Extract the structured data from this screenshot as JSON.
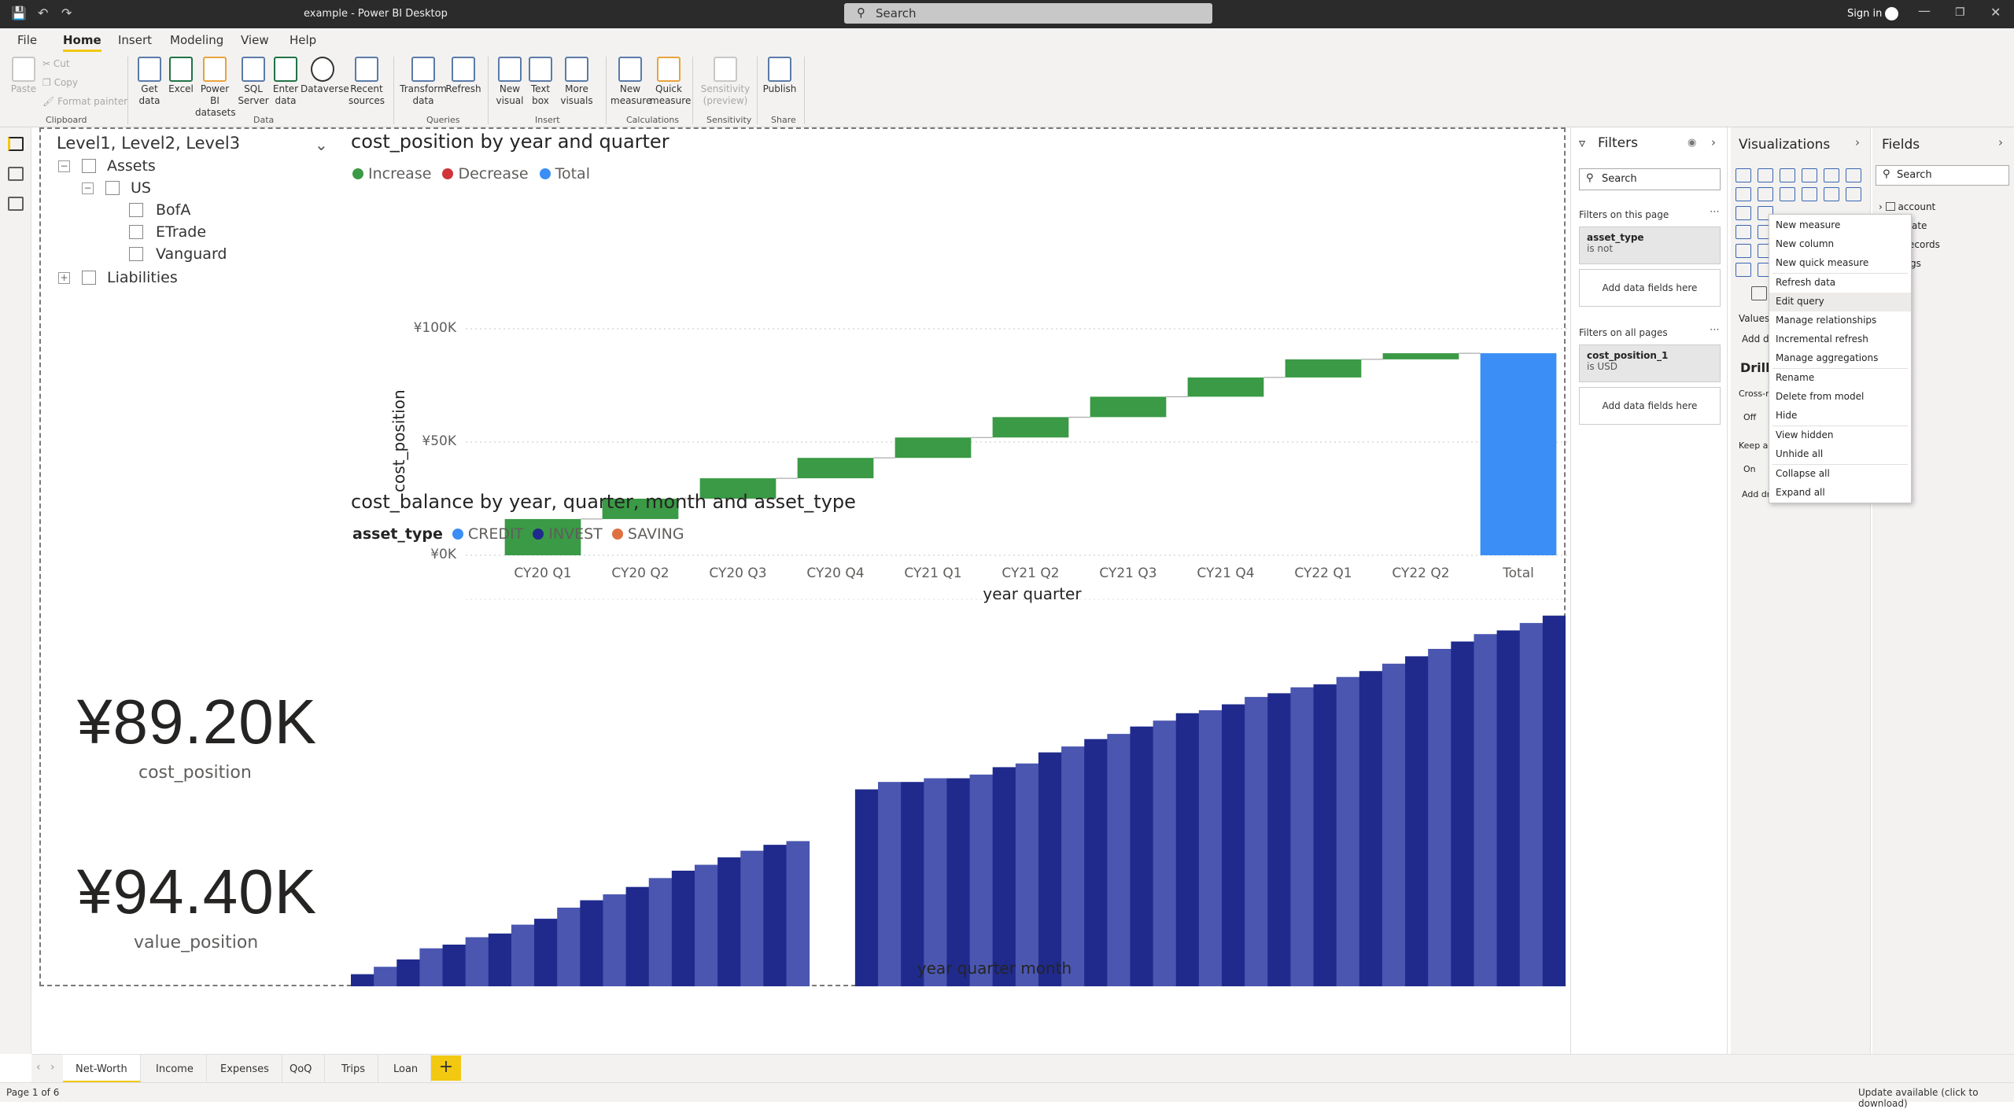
{
  "titlebar": {
    "title": "example - Power BI Desktop",
    "search_placeholder": "Search",
    "signin": "Sign in"
  },
  "menu": {
    "tabs": [
      "File",
      "Home",
      "Insert",
      "Modeling",
      "View",
      "Help"
    ]
  },
  "ribbon": {
    "clipboard": {
      "paste": "Paste",
      "cut": "Cut",
      "copy": "Copy",
      "format_painter": "Format painter",
      "group": "Clipboard"
    },
    "data": {
      "get_data": "Get data",
      "excel": "Excel",
      "powerbi_datasets": "Power BI datasets",
      "sql_server": "SQL Server",
      "enter_data": "Enter data",
      "dataverse": "Dataverse",
      "recent_sources": "Recent sources",
      "group": "Data"
    },
    "queries": {
      "transform": "Transform data",
      "refresh": "Refresh",
      "group": "Queries"
    },
    "insert": {
      "new_visual": "New visual",
      "text_box": "Text box",
      "more_visuals": "More visuals",
      "group": "Insert"
    },
    "calculations": {
      "new_measure": "New measure",
      "quick_measure": "Quick measure",
      "group": "Calculations"
    },
    "sensitivity": {
      "label": "Sensitivity (preview)",
      "group": "Sensitivity"
    },
    "share": {
      "publish": "Publish",
      "group": "Share"
    }
  },
  "slicer": {
    "title": "Level1, Level2, Level3",
    "items": [
      "Assets",
      "US",
      "BofA",
      "ETrade",
      "Vanguard",
      "Liabilities"
    ]
  },
  "waterfall": {
    "title": "cost_position by year and quarter",
    "legend": [
      "Increase",
      "Decrease",
      "Total"
    ],
    "ylabel": "cost_position",
    "xlabel": "year quarter",
    "yticks": [
      "¥100K",
      "¥50K",
      "¥0K"
    ]
  },
  "area": {
    "title": "cost_balance by year, quarter, month and asset_type",
    "legend_title": "asset_type",
    "legend": [
      "CREDIT",
      "INVEST",
      "SAVING"
    ],
    "xlabel": "year quarter month"
  },
  "cards": {
    "cost": {
      "value": "¥89.20K",
      "label": "cost_position"
    },
    "value": {
      "value": "¥94.40K",
      "label": "value_position"
    }
  },
  "filters": {
    "title": "Filters",
    "search": "Search",
    "this_page": "Filters on this page",
    "f1_name": "asset_type",
    "f1_state": "is not",
    "add": "Add data fields here",
    "all_pages": "Filters on all pages",
    "f2_name": "cost_position_1",
    "f2_state": "is USD"
  },
  "viz": {
    "title": "Visualizations",
    "values": "Values",
    "add_d": "Add d",
    "drill": "Drill",
    "cross": "Cross-r",
    "off": "Off",
    "keep": "Keep al",
    "on": "On",
    "add_dr": "Add dr"
  },
  "fields": {
    "title": "Fields",
    "search": "Search",
    "items": [
      "account",
      "ate",
      "ecords",
      "gs"
    ]
  },
  "context_menu": [
    "New measure",
    "New column",
    "New quick measure",
    "Refresh data",
    "Edit query",
    "Manage relationships",
    "Incremental refresh",
    "Manage aggregations",
    "Rename",
    "Delete from model",
    "Hide",
    "View hidden",
    "Unhide all",
    "Collapse all",
    "Expand all"
  ],
  "pages": [
    "Net-Worth",
    "Income",
    "Expenses",
    "QoQ",
    "Trips",
    "Loan"
  ],
  "status": {
    "page": "Page 1 of 6",
    "update": "Update available (click to download)"
  },
  "colors": {
    "increase": "#3a9a45",
    "decrease": "#d13438",
    "total": "#3a8ef5",
    "credit": "#3a8ef5",
    "invest": "#1f2a8c",
    "saving": "#e07040"
  },
  "chart_data": [
    {
      "type": "bar",
      "subtype": "waterfall",
      "title": "cost_position by year and quarter",
      "categories": [
        "CY20 Q1",
        "CY20 Q2",
        "CY20 Q3",
        "CY20 Q4",
        "CY21 Q1",
        "CY21 Q2",
        "CY21 Q3",
        "CY21 Q4",
        "CY22 Q1",
        "CY22 Q2",
        "Total"
      ],
      "start": [
        0,
        16000,
        25000,
        34000,
        43000,
        52000,
        61000,
        70000,
        78500,
        86500,
        0
      ],
      "end": [
        16000,
        25000,
        34000,
        43000,
        52000,
        61000,
        70000,
        78500,
        86500,
        89200,
        89200
      ],
      "xlabel": "year quarter",
      "ylabel": "cost_position",
      "ylim": [
        0,
        100000
      ]
    },
    {
      "type": "area",
      "title": "cost_balance by year, quarter, month and asset_type",
      "xlabel": "year quarter month",
      "series": [
        {
          "name": "INVEST",
          "values": [
            8,
            8.5,
            9.5,
            11,
            12,
            13,
            13.5,
            14.5,
            15.5,
            17,
            18,
            19,
            20,
            21.5,
            22.5,
            23.5,
            24.5,
            25.5,
            26.5,
            27,
            0,
            0,
            30,
            30.5,
            31,
            31.5,
            32,
            33,
            34,
            35,
            36.5,
            37.5,
            38.5,
            39.5,
            40.5,
            41.5,
            42.5,
            43,
            44,
            45,
            45.5,
            46.5,
            47,
            48,
            49,
            50,
            51,
            52,
            53,
            54,
            54.5,
            55.5,
            56.5
          ]
        },
        {
          "name": "SAVING",
          "values": [
            3,
            3.5,
            3.5,
            3.5,
            3,
            3,
            3,
            3.2,
            3,
            3,
            3,
            2.8,
            2.8,
            2.5,
            2.5,
            2.3,
            2.3,
            2.2,
            2,
            2,
            1.5,
            2.5,
            6,
            6.5,
            6,
            6,
            5.5,
            5,
            5,
            4.5,
            4.5,
            4.3,
            4.3,
            4,
            4,
            3.8,
            3.8,
            3.7,
            3.5,
            3.5,
            3.5,
            3.3,
            3.2,
            3.2,
            3,
            3,
            3,
            3,
            3,
            3,
            3,
            3,
            3
          ]
        },
        {
          "name": "CREDIT",
          "values": [
            -0.3,
            -0.3,
            -0.3,
            -0.3,
            -0.4,
            -0.4,
            -0.4,
            -0.4,
            -0.4,
            -0.4,
            -0.4,
            -0.4,
            -0.5,
            -0.5,
            -0.5,
            -0.5,
            -0.5,
            -0.5,
            -0.5,
            -0.5,
            -0.5,
            -0.5,
            -0.6,
            -0.6,
            -0.6,
            -0.7,
            -0.7,
            -0.8,
            -0.8,
            -0.9,
            -0.9,
            -1,
            -1,
            -1,
            -1.1,
            -1.1,
            -1.2,
            -1.2,
            -1.3,
            -1.3,
            -1.4,
            -1.4,
            -1.5,
            -1.5,
            -1.6,
            -1.6,
            -1.7,
            -1.7,
            -1.8,
            -1.8,
            -2,
            -2,
            -2.2
          ]
        }
      ]
    }
  ]
}
